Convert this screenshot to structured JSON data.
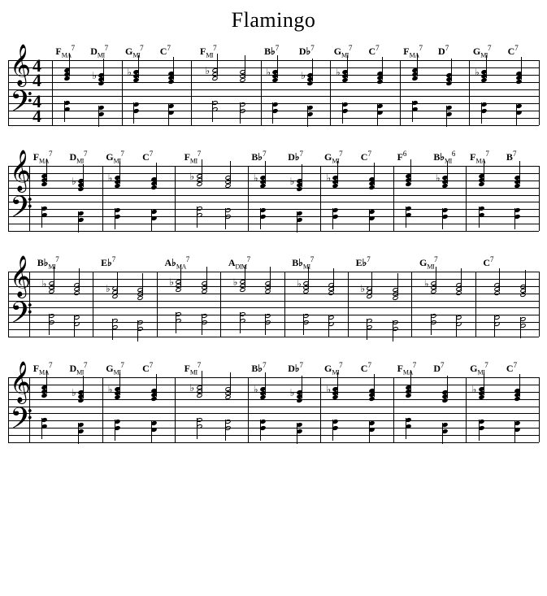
{
  "title": "Flamingo",
  "timeSignature": {
    "numerator": "4",
    "denominator": "4"
  },
  "systems": [
    {
      "showTimeSig": true,
      "measures": [
        {
          "chords": [
            "FMA7",
            "Dmi7"
          ]
        },
        {
          "chords": [
            "Gmi7",
            "C7"
          ]
        },
        {
          "chords": [
            "Fmi7"
          ]
        },
        {
          "chords": [
            "Bb7",
            "Db7"
          ]
        },
        {
          "chords": [
            "Gmi7",
            "C7"
          ]
        },
        {
          "chords": [
            "FMA7",
            "D7"
          ]
        },
        {
          "chords": [
            "Gmi7",
            "C7"
          ]
        }
      ]
    },
    {
      "showTimeSig": false,
      "measures": [
        {
          "chords": [
            "FMA7",
            "Dmi7"
          ]
        },
        {
          "chords": [
            "Gmi7",
            "C7"
          ]
        },
        {
          "chords": [
            "Fmi7"
          ]
        },
        {
          "chords": [
            "Bb7",
            "Db7"
          ]
        },
        {
          "chords": [
            "Gmi7",
            "C7"
          ]
        },
        {
          "chords": [
            "F6",
            "Bbmi6"
          ]
        },
        {
          "chords": [
            "FMA7",
            "B7"
          ]
        }
      ]
    },
    {
      "showTimeSig": false,
      "measures": [
        {
          "chords": [
            "Bbmi7"
          ]
        },
        {
          "chords": [
            "Eb7"
          ]
        },
        {
          "chords": [
            "AbMA7"
          ]
        },
        {
          "chords": [
            "Adim7"
          ]
        },
        {
          "chords": [
            "Bbmi7"
          ]
        },
        {
          "chords": [
            "Eb7"
          ]
        },
        {
          "chords": [
            "Gmi7"
          ]
        },
        {
          "chords": [
            "C7"
          ]
        }
      ]
    },
    {
      "showTimeSig": false,
      "measures": [
        {
          "chords": [
            "FMA7",
            "Dmi7"
          ]
        },
        {
          "chords": [
            "Gmi7",
            "C7"
          ]
        },
        {
          "chords": [
            "Fmi7"
          ]
        },
        {
          "chords": [
            "Bb7",
            "Db7"
          ]
        },
        {
          "chords": [
            "Gmi7",
            "C7"
          ]
        },
        {
          "chords": [
            "FMA7",
            "D7"
          ]
        },
        {
          "chords": [
            "Gmi7",
            "C7"
          ]
        }
      ]
    }
  ]
}
